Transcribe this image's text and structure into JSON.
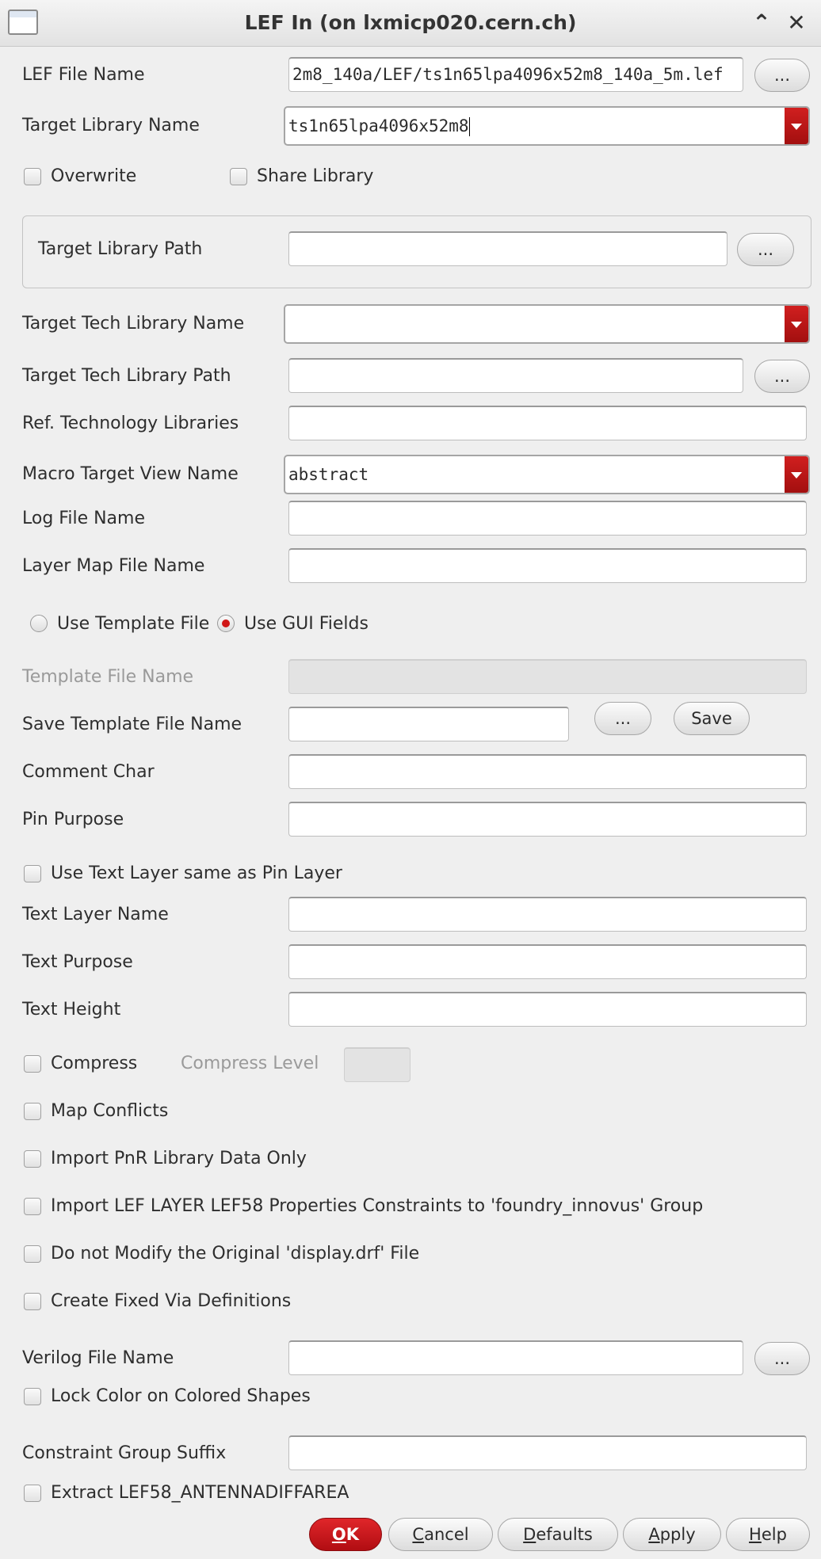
{
  "window": {
    "title": "LEF In (on lxmicp020.cern.ch)",
    "icons": [
      "window-icon",
      "maximize-icon",
      "close-icon"
    ]
  },
  "fields": {
    "lef_file_name": {
      "label": "LEF File Name",
      "value": "2m8_140a/LEF/ts1n65lpa4096x52m8_140a_5m.lef"
    },
    "target_library_name": {
      "label": "Target Library Name",
      "value": "ts1n65lpa4096x52m8"
    },
    "overwrite": {
      "label": "Overwrite",
      "checked": false
    },
    "share_library": {
      "label": "Share Library",
      "checked": false
    },
    "target_library_path": {
      "label": "Target Library Path",
      "value": ""
    },
    "target_tech_library_name": {
      "label": "Target Tech Library Name",
      "value": ""
    },
    "target_tech_library_path": {
      "label": "Target Tech Library Path",
      "value": ""
    },
    "ref_technology_libraries": {
      "label": "Ref. Technology Libraries",
      "value": ""
    },
    "macro_target_view_name": {
      "label": "Macro Target View Name",
      "value": "abstract"
    },
    "log_file_name": {
      "label": "Log File Name",
      "value": ""
    },
    "layer_map_file_name": {
      "label": "Layer Map File Name",
      "value": ""
    },
    "use_template_file": {
      "label": "Use Template File",
      "selected": false
    },
    "use_gui_fields": {
      "label": "Use GUI Fields",
      "selected": true
    },
    "template_file_name": {
      "label": "Template File Name",
      "value": ""
    },
    "save_template_file_name": {
      "label": "Save Template File Name",
      "value": ""
    },
    "comment_char": {
      "label": "Comment Char",
      "value": ""
    },
    "pin_purpose": {
      "label": "Pin Purpose",
      "value": ""
    },
    "use_text_layer_same": {
      "label": "Use Text Layer same as Pin Layer",
      "checked": false
    },
    "text_layer_name": {
      "label": "Text Layer Name",
      "value": ""
    },
    "text_purpose": {
      "label": "Text Purpose",
      "value": ""
    },
    "text_height": {
      "label": "Text Height",
      "value": ""
    },
    "compress": {
      "label": "Compress",
      "checked": false
    },
    "compress_level": {
      "label": "Compress Level",
      "value": ""
    },
    "map_conflicts": {
      "label": "Map Conflicts",
      "checked": false
    },
    "import_pnr_only": {
      "label": "Import PnR Library Data Only",
      "checked": false
    },
    "import_lef58": {
      "label": "Import LEF LAYER LEF58 Properties Constraints to 'foundry_innovus' Group",
      "checked": false
    },
    "no_modify_display": {
      "label": "Do not Modify the Original 'display.drf' File",
      "checked": false
    },
    "create_fixed_via": {
      "label": "Create Fixed Via Definitions",
      "checked": false
    },
    "verilog_file_name": {
      "label": "Verilog File Name",
      "value": ""
    },
    "lock_color": {
      "label": "Lock Color on Colored Shapes",
      "checked": false
    },
    "constraint_group_suffix": {
      "label": "Constraint Group Suffix",
      "value": ""
    },
    "extract_antenna": {
      "label": "Extract LEF58_ANTENNADIFFAREA",
      "checked": false
    }
  },
  "buttons": {
    "browse": "...",
    "save": "Save",
    "ok_mnemonic": "O",
    "ok_rest": "K",
    "cancel_mnemonic": "C",
    "cancel_rest": "ancel",
    "defaults_mnemonic": "D",
    "defaults_rest": "efaults",
    "apply_mnemonic": "A",
    "apply_rest": "pply",
    "help_mnemonic": "H",
    "help_rest": "elp"
  },
  "colors": {
    "accent": "#c0161b",
    "background": "#efefef"
  }
}
